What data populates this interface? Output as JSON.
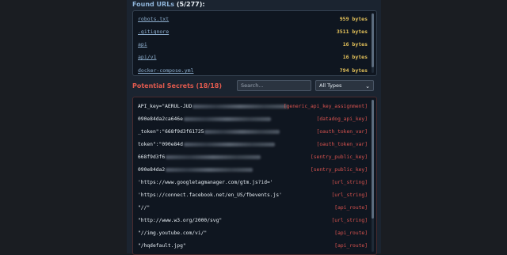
{
  "found_urls": {
    "title": "Found URLs",
    "count": "(5/277):",
    "items": [
      {
        "url": "robots.txt",
        "size": "959 bytes"
      },
      {
        "url": ".gitignore",
        "size": "3511 bytes"
      },
      {
        "url": "api",
        "size": "16 bytes"
      },
      {
        "url": "api/v1",
        "size": "16 bytes"
      },
      {
        "url": "docker-compose.yml",
        "size": "794 bytes"
      }
    ]
  },
  "secrets": {
    "title": "Potential Secrets",
    "count": "(18/18)",
    "search_placeholder": "Search...",
    "type_filter": "All Types",
    "items": [
      {
        "value": "API_key=\"AERUL-JUD",
        "type": "[generic_api_key_assignment]",
        "redacted": true
      },
      {
        "value": "090e84da2ca646e",
        "type": "[datadog_api_key]",
        "redacted": true
      },
      {
        "value": "_token\":\"668f9d3f61725",
        "type": "[oauth_token_var]",
        "redacted": true
      },
      {
        "value": "token\":\"090e84d",
        "type": "[oauth_token_var]",
        "redacted": true
      },
      {
        "value": "668f9d3f6",
        "type": "[sentry_public_key]",
        "redacted": true
      },
      {
        "value": "090e84da2",
        "type": "[sentry_public_key]",
        "redacted": true
      },
      {
        "value": "'https://www.googletagmanager.com/gtm.js?id='",
        "type": "[url_string]",
        "redacted": false
      },
      {
        "value": "'https://connect.facebook.net/en_US/fbevents.js'",
        "type": "[url_string]",
        "redacted": false
      },
      {
        "value": "\"//\"",
        "type": "[api_route]",
        "redacted": false
      },
      {
        "value": "\"http://www.w3.org/2000/svg\"",
        "type": "[url_string]",
        "redacted": false
      },
      {
        "value": "\"//img.youtube.com/vi/\"",
        "type": "[api_route]",
        "redacted": false
      },
      {
        "value": "\"/hqdefault.jpg\"",
        "type": "[api_route]",
        "redacted": false
      }
    ]
  }
}
